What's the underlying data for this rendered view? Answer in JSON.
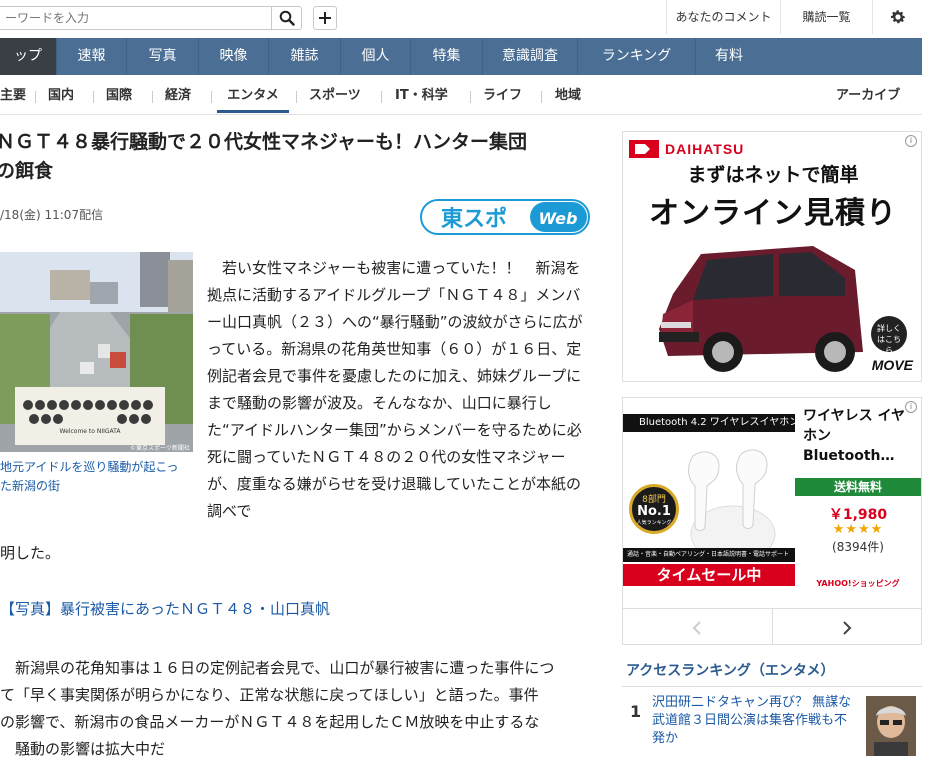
{
  "topbar": {
    "search_placeholder": "ーワードを入力",
    "comment_link": "あなたのコメント",
    "subscription_link": "購読一覧"
  },
  "gnav": [
    "ップ",
    "速報",
    "写真",
    "映像",
    "雑誌",
    "個人",
    "特集",
    "意識調査",
    "ランキング",
    "有料"
  ],
  "subnav": [
    "主要",
    "国内",
    "国際",
    "経済",
    "エンタメ",
    "スポーツ",
    "IT・科学",
    "ライフ",
    "地域"
  ],
  "archive_link": "アーカイブ",
  "article": {
    "title_line1": "ＮＧＴ４８暴行騒動で２０代女性マネジャーも！ハンター集団",
    "title_line2": "の餌食",
    "date": "/18(金) 11:07配信",
    "source_logo": "東スポWeb",
    "photo_sign": "Welcome to NIIGATA",
    "photo_credit": "©東京スポーツ新聞社",
    "caption": "地元アイドルを巡り騒動が起こった新潟の街",
    "lead": "　若い女性マネジャーも被害に遭っていた！！　新潟を拠点に活動するアイドルグループ「ＮＧＴ４８」メンバー山口真帆（２３）への“暴行騒動”の波紋がさらに広がっている。新潟県の花角英世知事（６０）が１６日、定例記者会見で事件を憂慮したのに加え、姉妹グループにまで騒動の影響が波及。そんななか、山口に暴行した“アイドルハンター集団”からメンバーを守るために必死に闘っていたＮＧＴ４８の２０代の女性マネジャーが、度重なる嫌がらせを受け退職していたことが本紙の調べで",
    "lead_tail": "明した。",
    "photo_link": "【写真】暴行被害にあったＮＧＴ４８・山口真帆",
    "para2_l1": "　新潟県の花角知事は１６日の定例記者会見で、山口が暴行被害に遭った事件につ",
    "para2_l2": "て「早く事実関係が明らかになり、正常な状態に戻ってほしい」と語った。事件",
    "para2_l3": "の影響で、新潟市の食品メーカーがＮＧＴ４８を起用したＣＭ放映を中止するな",
    "para2_l4": "　騒動の影響は拡大中だ"
  },
  "ad1": {
    "brand": "DAIHATSU",
    "headline1": "まずはネットで簡単",
    "headline2": "オンライン見積り",
    "detail_badge": "詳しくはこちら",
    "model": "MOVE"
  },
  "ad2": {
    "banner_top": "Bluetooth 4.2 ワイヤレスイヤホン",
    "rank_badge_top": "8部門",
    "rank_badge_main": "No.1",
    "rank_badge_sub": "人気ランキング",
    "strip_text": "通話・音楽・自動ペアリング・日本語説明書・電話サポート",
    "sale_banner": "タイムセール中",
    "product_title": "ワイヤレス イヤホン Bluetooth…",
    "shipping": "送料無料",
    "price": "￥1,980",
    "stars": "★★★★",
    "reviews": "(8394件)",
    "shop": "YAHOO!ショッピング"
  },
  "ranking": {
    "title": "アクセスランキング（エンタメ）",
    "items": [
      {
        "rank": "1",
        "text_l1": "沢田研二ドタキャン再び？ 無謀な",
        "text_l2": "武道館３日間公演は集客作戦も不",
        "text_l3": "発か"
      }
    ]
  },
  "colors": {
    "nav": "#4a6e94",
    "nav_active": "#3a3f46",
    "link": "#1a5aa6",
    "accent_red": "#d8001c"
  }
}
